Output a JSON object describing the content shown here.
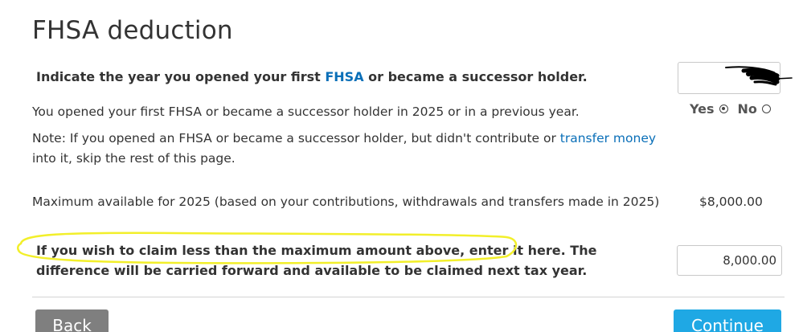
{
  "page": {
    "title": "FHSA deduction"
  },
  "year_question": {
    "prefix": "Indicate the year you opened your first ",
    "link": "FHSA",
    "suffix": " or became a successor holder.",
    "input_value": ""
  },
  "opened_question": {
    "text": "You opened your first FHSA or became a successor holder in 2025 or in a previous year.",
    "yes_label": "Yes",
    "no_label": "No",
    "selected": "Yes"
  },
  "note": {
    "prefix": "Note: If you opened an FHSA or became a successor holder, but didn't contribute or ",
    "link": "transfer money",
    "suffix": " into it, skip the rest of this page."
  },
  "maximum": {
    "label": "Maximum available for 2025 (based on your contributions, withdrawals and transfers made in 2025)",
    "amount": "$8,000.00"
  },
  "claim": {
    "text": "If you wish to claim less than the maximum amount above, enter it here. The difference will be carried forward and available to be claimed next tax year.",
    "input_value": "8,000.00"
  },
  "buttons": {
    "back": "Back",
    "continue": "Continue"
  },
  "colors": {
    "link": "#0a6fb8",
    "back_button": "#7f7f7f",
    "continue_button": "#1fa8e4",
    "highlight_annotation": "#f2ef2a",
    "scribble_annotation": "#000000"
  }
}
